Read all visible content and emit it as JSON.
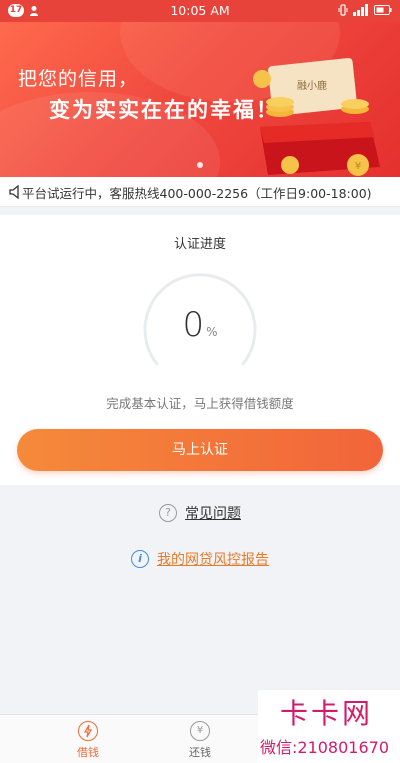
{
  "status_bar": {
    "badge": "17",
    "time": "10:05 AM"
  },
  "banner": {
    "line1": "把您的信用，",
    "line2": "变为实实在在的幸福！",
    "art_label": "融小鹿"
  },
  "notice": {
    "text": "平台试运行中，客服热线400-000-2256（工作日9:00-18:00)"
  },
  "progress": {
    "title": "认证进度",
    "value": "0",
    "unit": "%",
    "percent": 0,
    "description": "完成基本认证，马上获得借钱额度"
  },
  "cta": {
    "label": "马上认证"
  },
  "links": {
    "faq": "常见问题",
    "report": "我的网贷风控报告"
  },
  "bottom_nav": {
    "items": [
      {
        "label": "借钱",
        "icon": "lightning-icon",
        "active": true
      },
      {
        "label": "还钱",
        "icon": "yen-icon",
        "active": false
      }
    ]
  },
  "watermark": {
    "title": "卡卡网",
    "subtitle": "微信:210801670"
  },
  "colors": {
    "accent": "#f26a3a",
    "banner_red": "#e8433a",
    "link_orange": "#e87b2a",
    "watermark": "#d31b6c"
  }
}
